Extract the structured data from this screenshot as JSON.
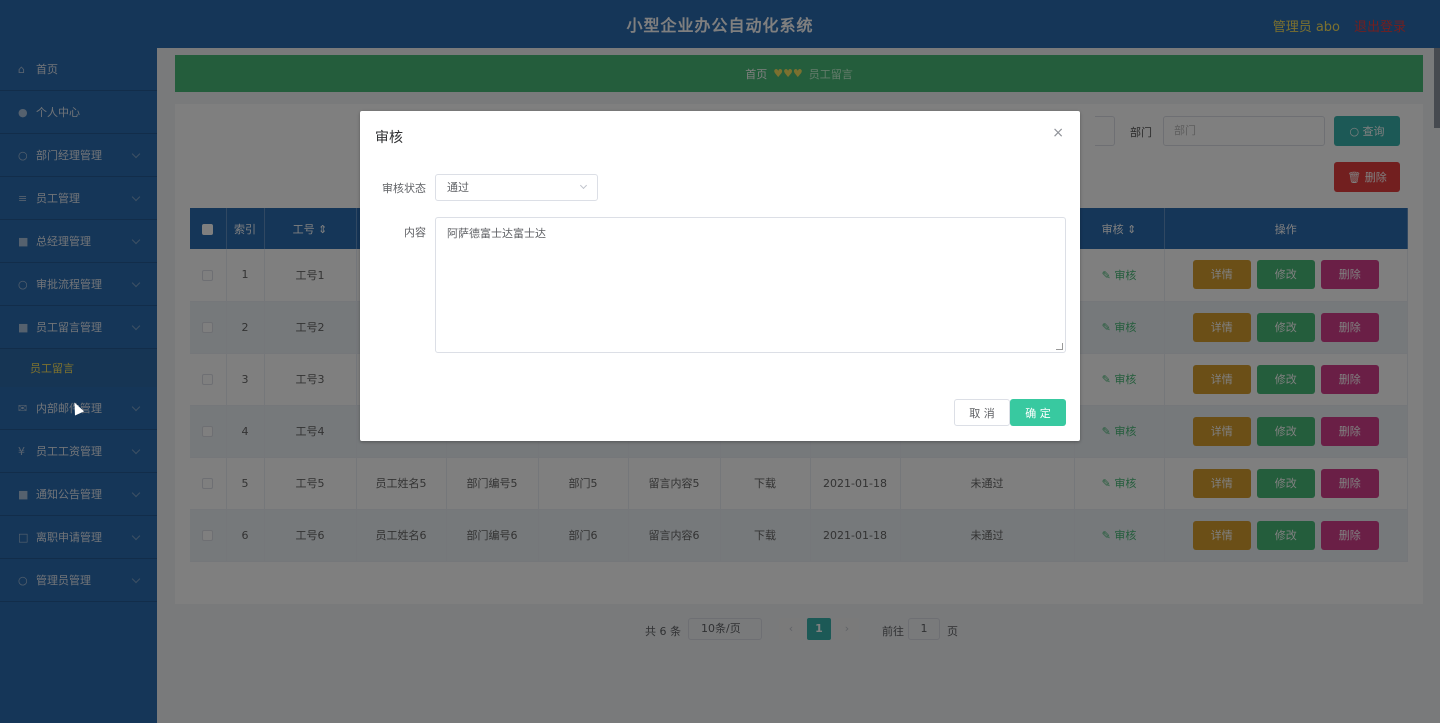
{
  "header": {
    "title": "小型企业办公自动化系统",
    "user": "管理员 abo",
    "logout": "退出登录"
  },
  "sidebar": {
    "items": [
      {
        "label": "首页"
      },
      {
        "label": "个人中心"
      },
      {
        "label": "部门经理管理"
      },
      {
        "label": "员工管理"
      },
      {
        "label": "总经理管理"
      },
      {
        "label": "审批流程管理"
      },
      {
        "label": "员工留言管理"
      }
    ],
    "sub_item": "员工留言",
    "items_after": [
      {
        "label": "内部邮件管理"
      },
      {
        "label": "员工工资管理"
      },
      {
        "label": "通知公告管理"
      },
      {
        "label": "离职申请管理"
      },
      {
        "label": "管理员管理"
      }
    ]
  },
  "breadcrumb": {
    "home": "首页",
    "sep": "♥♥♥",
    "current": "员工留言"
  },
  "search": {
    "dept_label": "部门",
    "dept_placeholder": "部门",
    "query_button": "查询",
    "delete_button": "删除"
  },
  "table": {
    "headers": {
      "index": "索引",
      "emp_no": "工号",
      "audit": "审核",
      "ops": "操作"
    },
    "rows": [
      {
        "index": "1",
        "emp_no": "工号1",
        "name": "",
        "dept_no": "",
        "dept": "",
        "content": "",
        "download": "",
        "date": "",
        "status": ""
      },
      {
        "index": "2",
        "emp_no": "工号2",
        "name": "",
        "dept_no": "",
        "dept": "",
        "content": "",
        "download": "",
        "date": "",
        "status": ""
      },
      {
        "index": "3",
        "emp_no": "工号3",
        "name": "",
        "dept_no": "",
        "dept": "",
        "content": "",
        "download": "",
        "date": "",
        "status": ""
      },
      {
        "index": "4",
        "emp_no": "工号4",
        "name": "",
        "dept_no": "",
        "dept": "",
        "content": "",
        "download": "",
        "date": "",
        "status": ""
      },
      {
        "index": "5",
        "emp_no": "工号5",
        "name": "员工姓名5",
        "dept_no": "部门编号5",
        "dept": "部门5",
        "content": "留言内容5",
        "download": "下载",
        "date": "2021-01-18",
        "status": "未通过"
      },
      {
        "index": "6",
        "emp_no": "工号6",
        "name": "员工姓名6",
        "dept_no": "部门编号6",
        "dept": "部门6",
        "content": "留言内容6",
        "download": "下载",
        "date": "2021-01-18",
        "status": "未通过"
      }
    ],
    "audit_link": "审核",
    "detail_btn": "详情",
    "edit_btn": "修改",
    "delete_btn": "删除"
  },
  "pager": {
    "total": "共 6 条",
    "size": "10条/页",
    "page": "1",
    "goto": "前往",
    "goto_value": "1",
    "page_word": "页"
  },
  "dialog": {
    "title": "审核",
    "status_label": "审核状态",
    "status_value": "通过",
    "content_label": "内容",
    "content_value": "阿萨德富士达富士达",
    "cancel": "取 消",
    "ok": "确 定"
  }
}
